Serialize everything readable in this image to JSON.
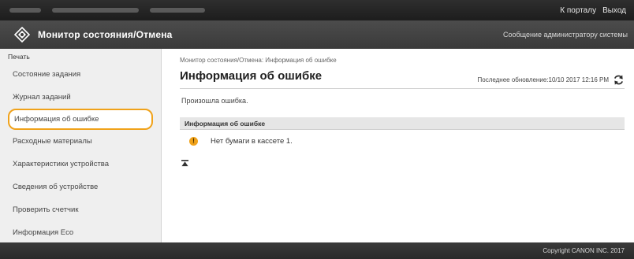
{
  "topbar": {
    "portal_link": "К порталу",
    "logout_link": "Выход"
  },
  "titlebar": {
    "title": "Монитор состояния/Отмена",
    "admin_message": "Сообщение администратору системы"
  },
  "sidebar": {
    "category": "Печать",
    "items": [
      {
        "label": "Состояние задания"
      },
      {
        "label": "Журнал заданий"
      },
      {
        "label": "Информация об ошибке",
        "active": true
      },
      {
        "label": "Расходные материалы"
      },
      {
        "label": "Характеристики устройства"
      },
      {
        "label": "Сведения об устройстве"
      },
      {
        "label": "Проверить счетчик"
      },
      {
        "label": "Информация Eco"
      }
    ]
  },
  "main": {
    "breadcrumb": "Монитор состояния/Отмена: Информация об ошибке",
    "page_title": "Информация об ошибке",
    "last_update": "Последнее обновление:10/10 2017 12:16 PM",
    "message": "Произошла ошибка.",
    "panel": {
      "header": "Информация об ошибке",
      "rows": [
        {
          "icon": "warning-icon",
          "text": "Нет бумаги в кассете 1."
        }
      ]
    }
  },
  "footer": {
    "copyright": "Copyright CANON INC. 2017"
  },
  "colors": {
    "accent_highlight": "#f0a21a",
    "topbar_bg": "#1d1d1d",
    "titlebar_bg": "#3a3a3a",
    "sidebar_bg": "#efefef"
  }
}
